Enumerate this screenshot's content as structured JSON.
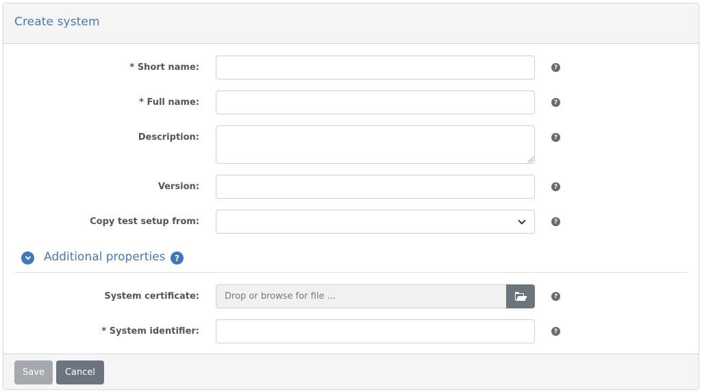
{
  "header": {
    "title": "Create system"
  },
  "form": {
    "short_name": {
      "label": "* Short name:",
      "value": ""
    },
    "full_name": {
      "label": "* Full name:",
      "value": ""
    },
    "description": {
      "label": "Description:",
      "value": ""
    },
    "version": {
      "label": "Version:",
      "value": ""
    },
    "copy_setup": {
      "label": "Copy test setup from:",
      "value": ""
    },
    "help_glyph": "?"
  },
  "additional": {
    "title": "Additional properties",
    "help_glyph": "?",
    "certificate": {
      "label": "System certificate:",
      "placeholder": "Drop or browse for file ..."
    },
    "identifier": {
      "label": "* System identifier:",
      "value": ""
    }
  },
  "footer": {
    "save_label": "Save",
    "cancel_label": "Cancel"
  },
  "icons": [
    "help-icon",
    "chevron-down-icon",
    "folder-open-icon"
  ],
  "colors": {
    "accent": "#4a78ad",
    "toggle": "#3f77b7",
    "secondary_button": "#6c757d",
    "disabled_button": "#a5a9ad"
  }
}
